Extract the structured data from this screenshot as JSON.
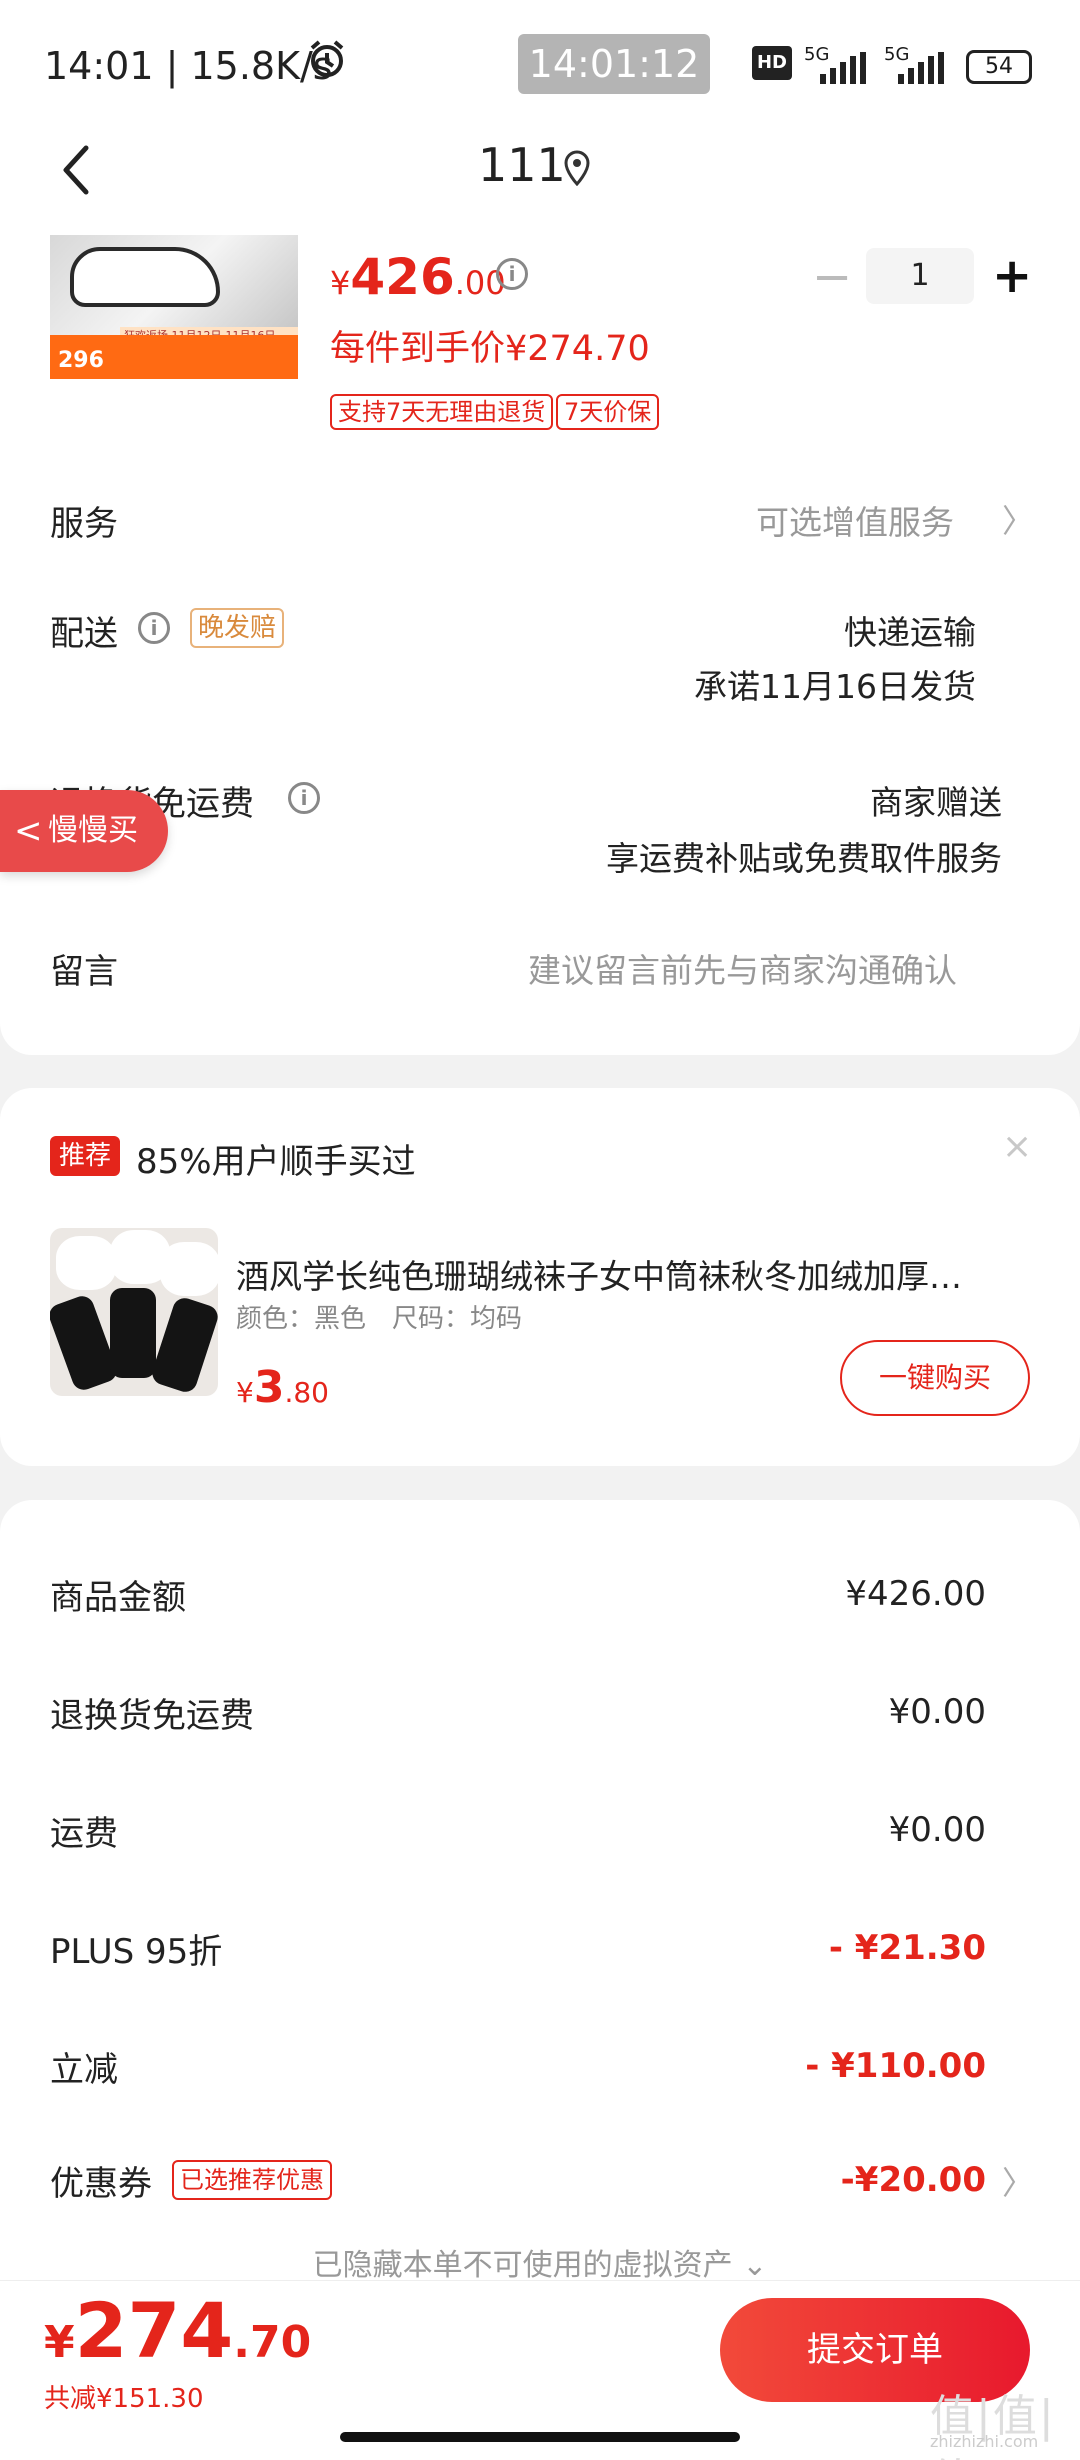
{
  "status_bar": {
    "left": "14:01 | 15.8K/s",
    "center_time": "14:01:12",
    "signal1": "5G",
    "signal2": "5G",
    "battery": "54",
    "hd": "HD"
  },
  "nav": {
    "title": "111"
  },
  "product": {
    "price_yen": "¥",
    "price_int": "426",
    "price_dec": ".00",
    "per_price": "每件到手价¥274.70",
    "tag1": "支持7天无理由退货",
    "tag2": "7天价保",
    "qty": "1",
    "minus": "−",
    "plus": "+",
    "img_number": "296",
    "img_strip": "狂欢返场 11月12日-11月16日"
  },
  "rows": {
    "service_label": "服务",
    "service_value": "可选增值服务",
    "delivery_label": "配送",
    "delivery_badge": "晚发赔",
    "delivery_value1": "快递运输",
    "delivery_value2": "承诺11月16日发货",
    "return_label": "退换货免运费",
    "return_value1": "商家赠送",
    "return_value2": "享运费补贴或免费取件服务",
    "note_label": "留言",
    "note_placeholder": "建议留言前先与商家沟通确认",
    "chevron": "〉"
  },
  "float_button": {
    "label": "慢慢买",
    "arrow": "<"
  },
  "recommend": {
    "badge": "推荐",
    "title": "85%用户顺手买过",
    "close": "×",
    "name": "酒风学长纯色珊瑚绒袜子女中筒袜秋冬加绒加厚…",
    "attr": "颜色：黑色　尺码：均码",
    "price_yen": "¥",
    "price_int": "3",
    "price_dec": ".80",
    "buy_label": "一键购买"
  },
  "summary": {
    "goods_label": "商品金额",
    "goods_value": "¥426.00",
    "return_label": "退换货免运费",
    "return_value": "¥0.00",
    "ship_label": "运费",
    "ship_value": "¥0.00",
    "plus_label": "PLUS 95折",
    "plus_value": "- ¥21.30",
    "cut_label": "立减",
    "cut_value": "- ¥110.00",
    "coupon_label": "优惠券",
    "coupon_badge": "已选推荐优惠",
    "coupon_value": "-¥20.00",
    "hidden_note": "已隐藏本单不可使用的虚拟资产 ⌄"
  },
  "bottom": {
    "total_yen": "¥",
    "total_int": "274",
    "total_dec": ".70",
    "saved": "共减¥151.30",
    "submit": "提交订单",
    "watermark": "值|值|值",
    "watermark_url": "zhizhizhi.com"
  },
  "colors": {
    "accent": "#e4251b",
    "badge_orange": "#d98a3c",
    "muted": "#999999"
  }
}
